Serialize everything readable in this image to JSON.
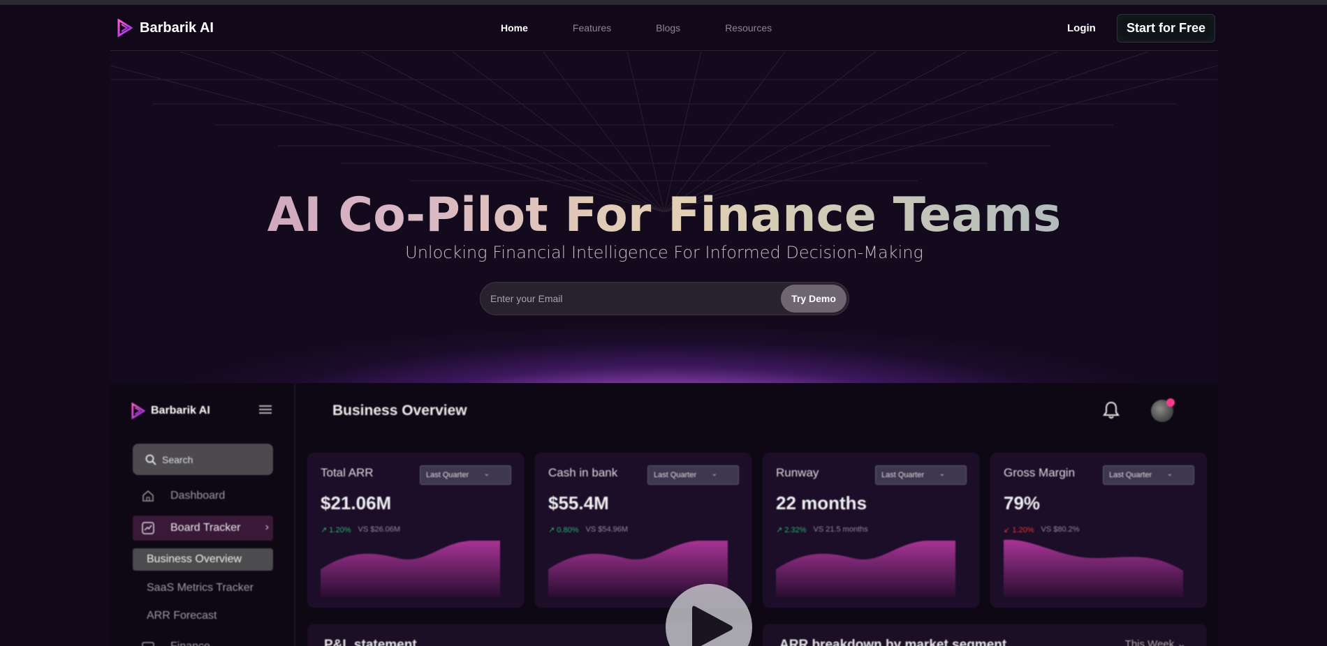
{
  "nav": {
    "brand": "Barbarik AI",
    "links": [
      "Home",
      "Features",
      "Blogs",
      "Resources"
    ],
    "login": "Login",
    "cta": "Start for Free"
  },
  "hero": {
    "title": "AI Co-Pilot For Finance Teams",
    "subtitle": "Unlocking Financial Intelligence For Informed Decision-Making",
    "email_placeholder": "Enter your Email",
    "button": "Try Demo"
  },
  "dashboard": {
    "brand": "Barbarik AI",
    "search": "Search",
    "nav_items": [
      "Dashboard",
      "Board Tracker"
    ],
    "sub_items": [
      "Business Overview",
      "SaaS Metrics Tracker",
      "ARR Forecast"
    ],
    "partial_item": "Finance",
    "title": "Business Overview",
    "cards": [
      {
        "title": "Total ARR",
        "period": "Last Quarter",
        "value": "$21.06M",
        "delta": "1.20%",
        "direction": "up",
        "compare": "VS $26.06M"
      },
      {
        "title": "Cash in bank",
        "period": "Last Quarter",
        "value": "$55.4M",
        "delta": "0.80%",
        "direction": "up",
        "compare": "VS $54.96M"
      },
      {
        "title": "Runway",
        "period": "Last Quarter",
        "value": "22 months",
        "delta": "2.32%",
        "direction": "up",
        "compare": "VS 21.5 months"
      },
      {
        "title": "Gross Margin",
        "period": "Last Quarter",
        "value": "79%",
        "delta": "1.20%",
        "direction": "down",
        "compare": "VS $80.2%"
      }
    ],
    "bottom_left_title": "P&L statement",
    "bottom_right_title": "ARR breakdown by market segment",
    "bottom_right_period": "This Week"
  },
  "colors": {
    "background": "#110819",
    "accent": "#c13aa8",
    "up": "#27b36b",
    "down": "#e3352f"
  }
}
